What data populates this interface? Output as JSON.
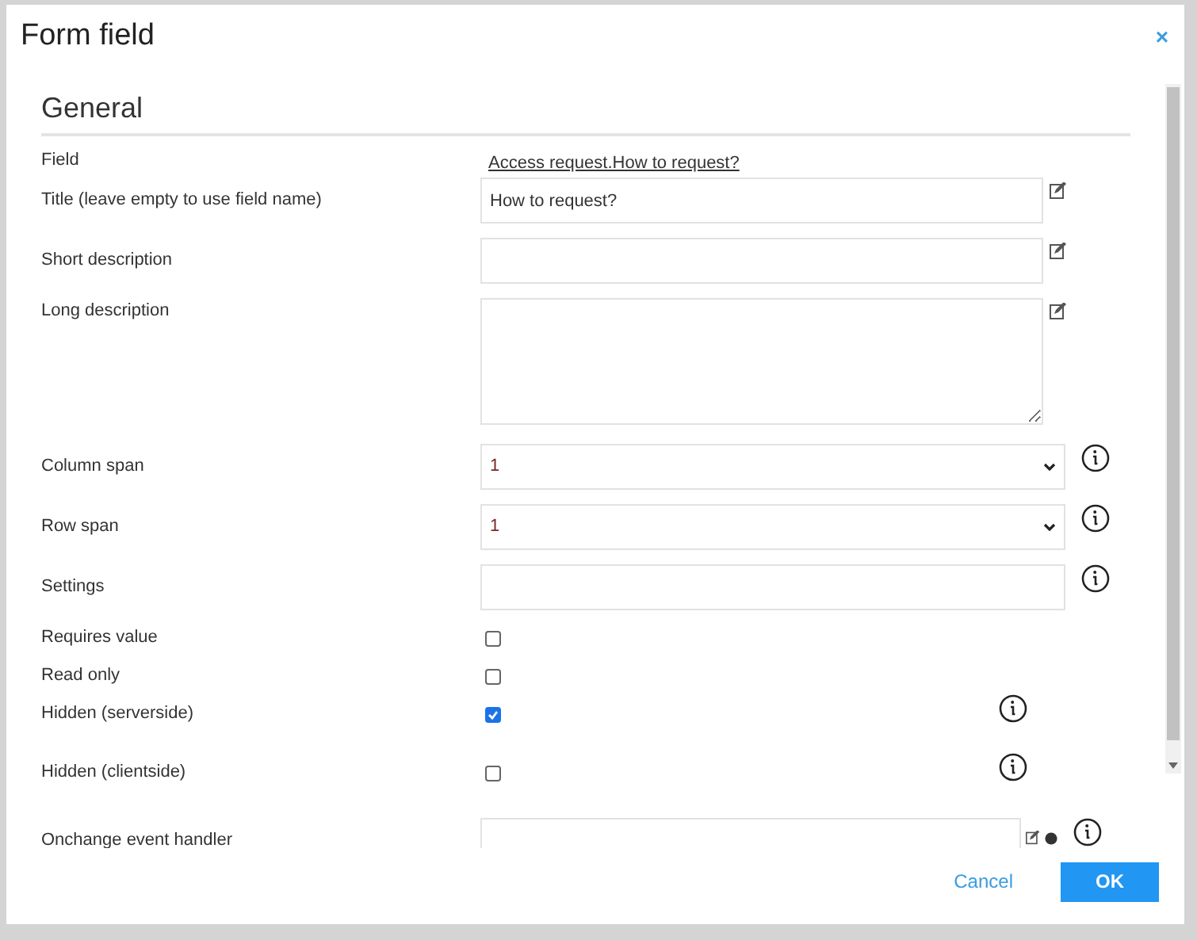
{
  "dialog": {
    "title": "Form field",
    "close": "×"
  },
  "section": {
    "title": "General"
  },
  "rows": [
    {
      "kind": "link",
      "label": "Field",
      "value": "Access request.How to request?"
    },
    {
      "kind": "text",
      "label": "Title (leave empty to use field name)",
      "value": "How to request?",
      "translatable": true
    },
    {
      "kind": "text",
      "label": "Short description",
      "translatable": true
    },
    {
      "kind": "textarea",
      "label": "Long description",
      "translatable": true
    },
    {
      "kind": "select",
      "label": "Column span",
      "value": "1",
      "help": true
    },
    {
      "kind": "select",
      "label": "Row span",
      "value": "1",
      "help": true
    },
    {
      "kind": "text",
      "label": "Settings",
      "help": true
    },
    {
      "kind": "checkbox",
      "label": "Requires value",
      "checked": false
    },
    {
      "kind": "checkbox",
      "label": "Read only",
      "checked": false
    },
    {
      "kind": "checkbox",
      "label": "Hidden (serverside)",
      "checked": true,
      "help": true
    },
    {
      "kind": "checkbox",
      "label": "Hidden (clientside)",
      "checked": false,
      "help": true
    },
    {
      "kind": "script",
      "label": "Onchange event handler",
      "translatable": true,
      "help": true
    }
  ],
  "buttons": [
    {
      "kind": "secondary",
      "label": "Cancel"
    },
    {
      "kind": "primary",
      "label": "OK"
    }
  ]
}
